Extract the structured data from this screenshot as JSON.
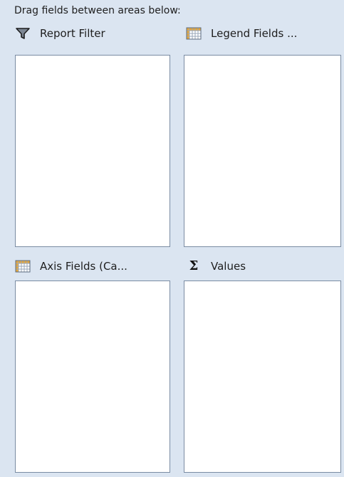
{
  "instruction": "Drag fields between areas below:",
  "areas": {
    "report_filter": {
      "label": "Report Filter",
      "icon": "filter-icon"
    },
    "legend_fields": {
      "label": "Legend Fields ...",
      "icon": "table-grid-icon"
    },
    "axis_fields": {
      "label": "Axis Fields (Ca...",
      "icon": "table-grid-icon"
    },
    "values": {
      "label": "Values",
      "icon": "sigma-icon",
      "icon_glyph": "Σ"
    }
  },
  "colors": {
    "panel_background": "#dbe5f1",
    "dropzone_background": "#ffffff",
    "dropzone_border": "#7a8ca3"
  }
}
